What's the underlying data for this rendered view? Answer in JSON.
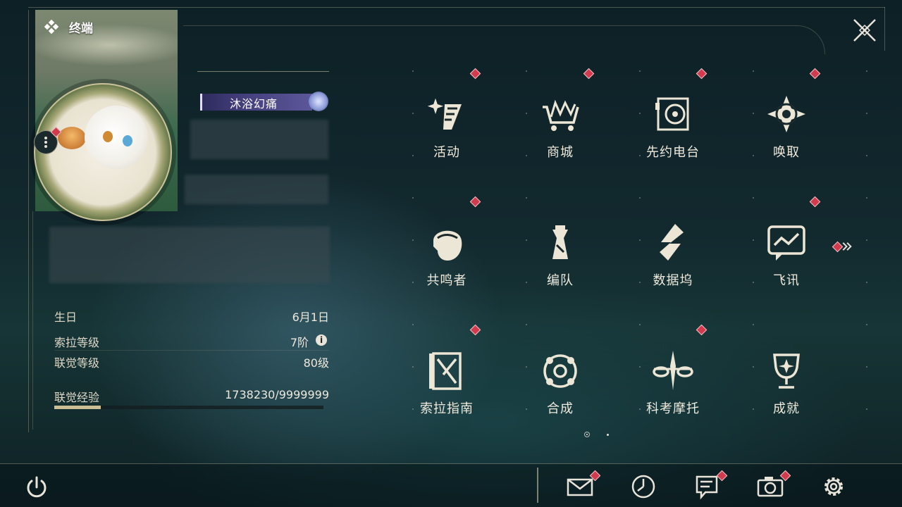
{
  "terminal": {
    "title": "终端"
  },
  "profile": {
    "name_plate": "沐浴幻痛",
    "stats": [
      {
        "label": "生日",
        "value": "6月1日"
      },
      {
        "label": "索拉等级",
        "value": "7阶"
      },
      {
        "label": "联觉等级",
        "value": "80级"
      },
      {
        "label": "联觉经验",
        "value": "1738230/9999999"
      }
    ],
    "exp_fraction": 0.174
  },
  "menu": {
    "items": [
      {
        "label": "活动",
        "icon": "sparkle-event-icon",
        "badge": true
      },
      {
        "label": "商城",
        "icon": "shop-cart-icon",
        "badge": true
      },
      {
        "label": "先约电台",
        "icon": "radio-icon",
        "badge": true
      },
      {
        "label": "唤取",
        "icon": "summon-compass-icon",
        "badge": true
      },
      {
        "label": "共鸣者",
        "icon": "resonator-portrait-icon",
        "badge": true
      },
      {
        "label": "编队",
        "icon": "team-chess-icon",
        "badge": false
      },
      {
        "label": "数据坞",
        "icon": "data-bank-icon",
        "badge": false
      },
      {
        "label": "飞讯",
        "icon": "message-icon",
        "badge": true
      },
      {
        "label": "索拉指南",
        "icon": "guide-book-icon",
        "badge": true
      },
      {
        "label": "合成",
        "icon": "synthesis-icon",
        "badge": false
      },
      {
        "label": "科考摩托",
        "icon": "motorcycle-icon",
        "badge": true
      },
      {
        "label": "成就",
        "icon": "trophy-icon",
        "badge": false
      }
    ],
    "page_count": 2,
    "current_page": 1
  },
  "bottom_bar": {
    "icons": [
      "mail-icon",
      "clock-icon",
      "notice-icon",
      "camera-icon",
      "settings-gear-icon"
    ]
  },
  "colors": {
    "badge": "#d23b4e",
    "accent": "#cdbf95",
    "name_plate": "#45407e"
  }
}
